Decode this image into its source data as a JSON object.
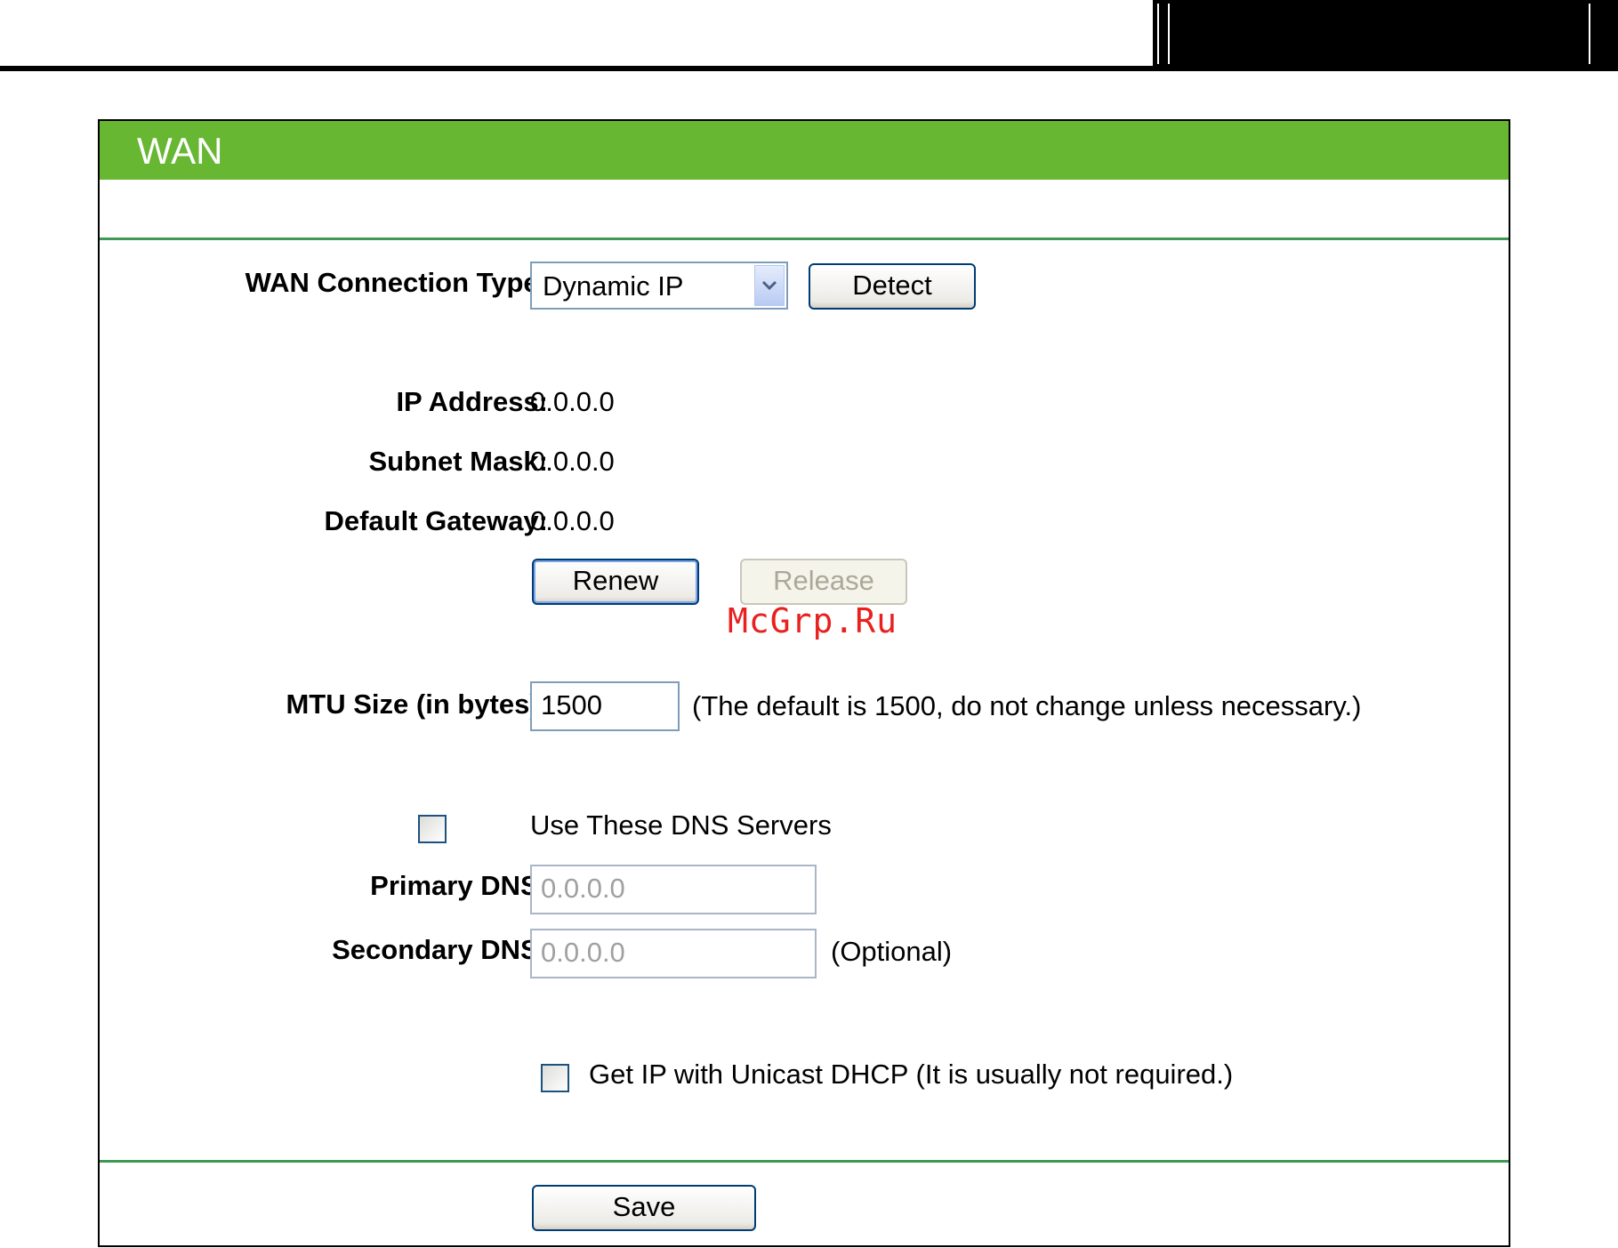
{
  "title": "WAN",
  "connection_type": {
    "label": "WAN Connection Type:",
    "selected": "Dynamic IP",
    "detect_label": "Detect"
  },
  "ip_address": {
    "label": "IP Address:",
    "value": "0.0.0.0"
  },
  "subnet_mask": {
    "label": "Subnet Mask:",
    "value": "0.0.0.0"
  },
  "default_gateway": {
    "label": "Default Gateway:",
    "value": "0.0.0.0"
  },
  "renew_label": "Renew",
  "release_label": "Release",
  "watermark": "McGrp.Ru",
  "mtu": {
    "label": "MTU Size (in bytes):",
    "value": "1500",
    "hint": "(The default is 1500, do not change unless necessary.)"
  },
  "dns": {
    "use_label": "Use These DNS Servers",
    "use_checked": false,
    "primary_label": "Primary DNS:",
    "primary_value": "0.0.0.0",
    "secondary_label": "Secondary DNS:",
    "secondary_value": "0.0.0.0",
    "optional": "(Optional)"
  },
  "unicast": {
    "label": "Get IP with Unicast DHCP (It is usually not required.)",
    "checked": false
  },
  "save_label": "Save",
  "colors": {
    "title_bar": "#67b733",
    "divider": "#3e9a52",
    "watermark": "#e8211f"
  }
}
